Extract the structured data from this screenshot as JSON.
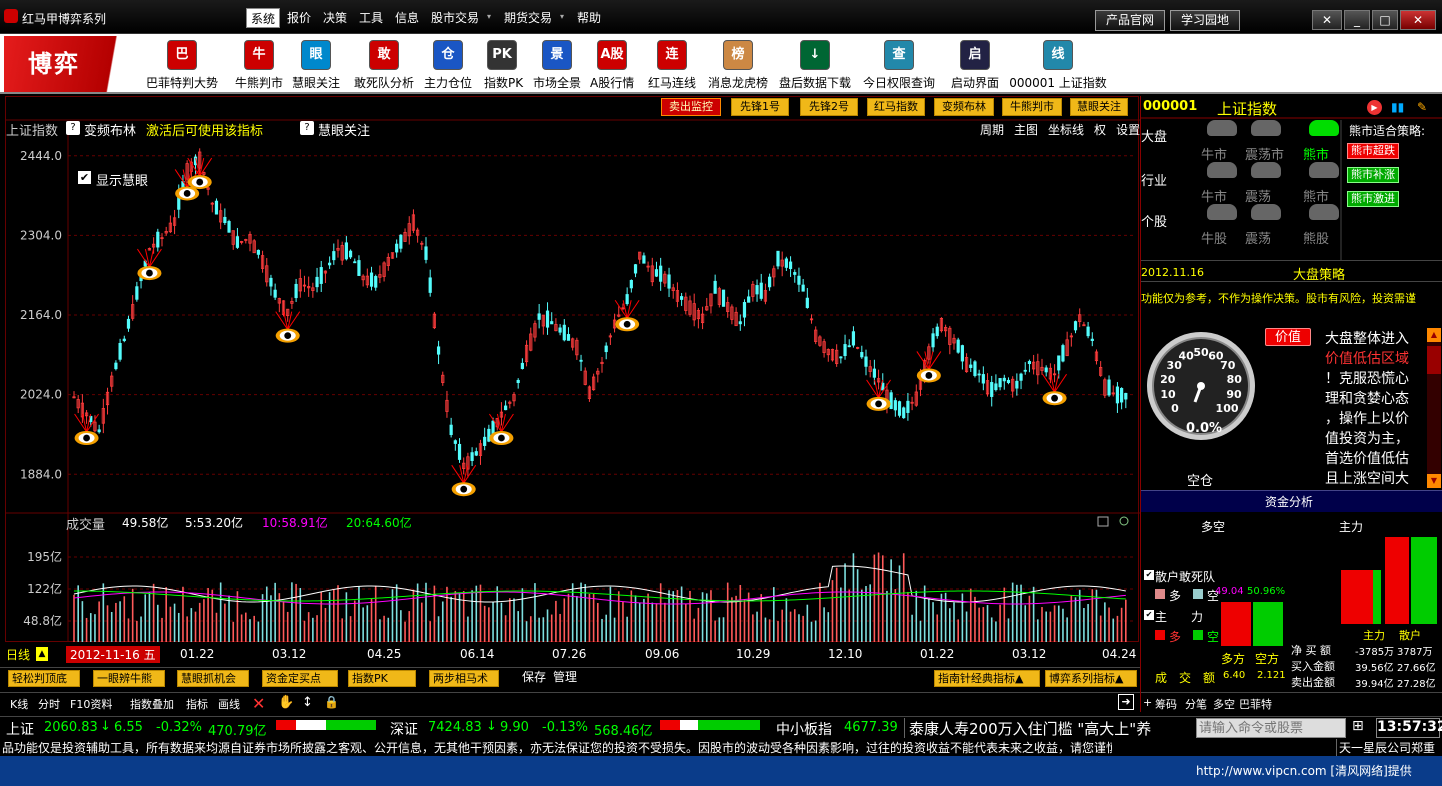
{
  "app": {
    "title": "红马甲博弈系列"
  },
  "menu": [
    "系统",
    "报价",
    "决策",
    "工具",
    "信息",
    "股市交易",
    "期货交易",
    "帮助"
  ],
  "title_buttons": [
    "产品官网",
    "学习园地"
  ],
  "window_buttons": [
    "✕",
    "_",
    "□",
    "✕"
  ],
  "brand": "博弈",
  "tools": [
    {
      "label": "巴菲特判大势",
      "icon": "巴",
      "color": "#c00"
    },
    {
      "label": "牛熊判市",
      "icon": "牛",
      "color": "#c00"
    },
    {
      "label": "慧眼关注",
      "icon": "眼",
      "color": "#0088cc"
    },
    {
      "label": "敢死队分析",
      "icon": "敢",
      "color": "#c00"
    },
    {
      "label": "主力仓位",
      "icon": "仓",
      "color": "#1a56c4"
    },
    {
      "label": "指数PK",
      "icon": "PK",
      "color": "#333"
    },
    {
      "label": "市场全景",
      "icon": "景",
      "color": "#1a56c4"
    },
    {
      "label": "A股行情",
      "icon": "A股",
      "color": "#c00"
    },
    {
      "label": "红马连线",
      "icon": "连",
      "color": "#c00"
    },
    {
      "label": "消息龙虎榜",
      "icon": "榜",
      "color": "#c84"
    },
    {
      "label": "盘后数据下载",
      "icon": "↓",
      "color": "#063"
    },
    {
      "label": "今日权限查询",
      "icon": "查",
      "color": "#28a"
    },
    {
      "label": "启动界面",
      "icon": "启",
      "color": "#224"
    },
    {
      "label": "000001 上证指数",
      "icon": "线",
      "color": "#28a"
    }
  ],
  "chart_top_buttons": [
    "卖出监控",
    "先锋1号",
    "先锋2号",
    "红马指数",
    "变频布林",
    "牛熊判市",
    "慧眼关注"
  ],
  "chart_header": {
    "left": "上证指数",
    "q1": "变频布林",
    "tip": "激活后可使用该指标",
    "q2": "慧眼关注",
    "right": [
      "周期",
      "主图",
      "坐标线",
      "权",
      "设置"
    ]
  },
  "checkbox_label": "显示慧眼",
  "chart_data": {
    "type": "line",
    "title": "上证指数",
    "y_ticks": [
      "2444.0",
      "2304.0",
      "2164.0",
      "2024.0",
      "1884.0"
    ],
    "x_ticks": [
      "01.22",
      "03.12",
      "04.25",
      "06.14",
      "07.26",
      "09.06",
      "10.29",
      "12.10",
      "01.22",
      "03.12",
      "04.24"
    ],
    "ylim": [
      1830,
      2470
    ],
    "date_label": "2012-11-16",
    "weekday_label": "五",
    "series": [
      {
        "values": [
          2020,
          1990,
          1960,
          2050,
          2120,
          2200,
          2280,
          2300,
          2330,
          2420,
          2440,
          2360,
          2330,
          2290,
          2300,
          2260,
          2200,
          2170,
          2220,
          2210,
          2240,
          2280,
          2270,
          2230,
          2220,
          2260,
          2290,
          2330,
          2270,
          2100,
          1960,
          1900,
          1920,
          1950,
          1990,
          2020,
          2100,
          2160,
          2150,
          2130,
          2110,
          2030,
          2080,
          2150,
          2190,
          2270,
          2240,
          2230,
          2200,
          2180,
          2160,
          2210,
          2180,
          2150,
          2210,
          2200,
          2260,
          2250,
          2210,
          2130,
          2100,
          2090,
          2120,
          2080,
          2050,
          2010,
          1990,
          2020,
          2100,
          2150,
          2120,
          2080,
          2060,
          2030,
          2050,
          2040,
          2080,
          2070,
          2060,
          2110,
          2160,
          2120,
          2040,
          2020
        ]
      }
    ]
  },
  "volume": {
    "title": "成交量",
    "v1": "49.58亿",
    "v2": "5:53.20亿",
    "v3": "10:58.91亿",
    "v4": "20:64.60亿",
    "ticks": [
      "195亿",
      "122亿",
      "48.8亿"
    ]
  },
  "bottom_buttons": [
    "轻松判顶底",
    "一眼辨牛熊",
    "慧眼抓机会",
    "资金定买点",
    "指数PK",
    "两步相马术"
  ],
  "bottom_links": [
    "保存",
    "管理"
  ],
  "bottom_right_buttons": [
    "指南针经典指标▲",
    "博弈系列指标▲"
  ],
  "bottom_tabs": [
    "K线",
    "分时",
    "F10资料",
    "指数叠加",
    "指标",
    "画线"
  ],
  "right": {
    "code": "000001",
    "name": "上证指数",
    "rows": [
      {
        "label": "大盘",
        "items": [
          "牛市",
          "震荡市",
          "熊市"
        ]
      },
      {
        "label": "行业",
        "items": [
          "牛市",
          "震荡",
          "熊市"
        ]
      },
      {
        "label": "个股",
        "items": [
          "牛股",
          "震荡",
          "熊股"
        ]
      }
    ],
    "strategy_title": "熊市适合策略:",
    "strategy_btns": [
      "熊市超跌",
      "熊市补涨",
      "熊市激进"
    ],
    "date": "2012.11.16",
    "strategy_label": "大盘策略",
    "disclaimer": "功能仅为参考，不作为操作决策。股市有风险，投资需谨",
    "value_btn": "价值",
    "advice": [
      "大盘整体进入",
      "价值低估区域",
      "！克服恐慌心",
      "理和贪婪心态",
      "，操作上以价",
      "值投资为主，",
      "首选价值低估",
      "且上涨空间大"
    ],
    "gauge_value": "0.0%",
    "gauge_ticks": [
      "0",
      "10",
      "20",
      "30",
      "40",
      "50",
      "60",
      "70",
      "80",
      "90",
      "100"
    ],
    "position": "空仓",
    "fund_title": "资金分析",
    "fund_head": [
      "多空",
      "主力"
    ],
    "retail_label": "散户敢死队",
    "duo": "多",
    "kong": "空",
    "pct1": "49.04",
    "pct2": "50.96%",
    "main_label": "主",
    "main_label2": "力",
    "duofang": "多方",
    "kongfang": "空方",
    "cj": "成　交　额",
    "cjval": "6.40",
    "cjval2": "2.121",
    "main_retail": [
      "主力",
      "散户"
    ],
    "net": [
      "净 买 额",
      "-3785万",
      "3787万"
    ],
    "buy": [
      "买入金额",
      "39.56亿",
      "27.66亿"
    ],
    "sell": [
      "卖出金额",
      "39.94亿",
      "27.28亿"
    ],
    "foot": [
      "筹码",
      "分笔",
      "多空",
      "巴菲特"
    ]
  },
  "ticker": {
    "sh": "上证",
    "sh_val": "2060.83",
    "sh_chg": "6.55",
    "sh_pct": "-0.32%",
    "sh_amt": "470.79亿",
    "sz": "深证",
    "sz_val": "7424.83",
    "sz_chg": "9.90",
    "sz_pct": "-0.13%",
    "sz_amt": "568.46亿",
    "zx": "中小板指",
    "zx_val": "4677.39",
    "news": "泰康人寿200万入住门槛 \"高大上\"养",
    "cmd_placeholder": "请输入命令或股票",
    "time": "13:57:32"
  },
  "disclaimer_bar": "品功能仅是投资辅助工具，所有数据来均源自证券市场所披露之客观、公开信息，无其他干预因素，亦无法保证您的投资不受损失。因股市的波动受各种因素影响，过往的投资收益不能代表未来之收益，请您谨慎做出投资决策!",
  "company": "天一星辰公司郑重",
  "watermark": "http://www.vipcn.com [清风网络]提供"
}
